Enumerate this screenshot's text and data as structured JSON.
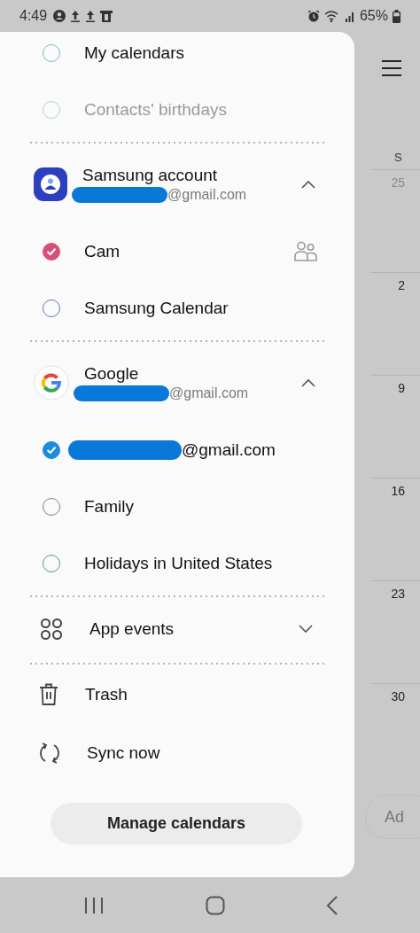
{
  "status_bar": {
    "time": "4:49",
    "battery": "65%"
  },
  "drawer": {
    "sections": [
      {
        "kind": "list",
        "items": [
          {
            "label": "My calendars",
            "redacted": false,
            "checked": false,
            "disabled": false,
            "shared": false,
            "color": "#7fb8c2"
          },
          {
            "label": "Contacts' birthdays",
            "redacted": false,
            "checked": false,
            "disabled": true,
            "shared": false,
            "color": "#a9d3da"
          }
        ]
      },
      {
        "kind": "account",
        "account": {
          "name": "Samsung account",
          "email": "@gmail.com",
          "redacted": true,
          "expanded": true
        },
        "items": [
          {
            "label": "Cam",
            "redacted": false,
            "checked": true,
            "disabled": false,
            "shared": true,
            "color": "#d6517a"
          },
          {
            "label": "Samsung Calendar",
            "redacted": false,
            "checked": false,
            "disabled": false,
            "shared": false,
            "color": "#5a7ab8"
          }
        ]
      },
      {
        "kind": "account",
        "account": {
          "name": "Google",
          "email": "@gmail.com",
          "redacted": true,
          "expanded": true
        },
        "items": [
          {
            "label": "@gmail.com",
            "redacted": true,
            "checked": true,
            "disabled": false,
            "shared": false,
            "color": "#1a8ddc"
          },
          {
            "label": "Family",
            "redacted": false,
            "checked": false,
            "disabled": false,
            "shared": false,
            "color": "#8a7d74"
          },
          {
            "label": "Holidays in United States",
            "redacted": false,
            "checked": false,
            "disabled": false,
            "shared": false,
            "color": "#4f9c84"
          }
        ]
      },
      {
        "kind": "group",
        "label": "App events",
        "expanded": false
      },
      {
        "kind": "actions",
        "items": [
          {
            "label": "Trash"
          },
          {
            "label": "Sync now"
          }
        ]
      }
    ],
    "manage_button": "Manage calendars"
  },
  "calendar": {
    "weekday": "S",
    "dates": [
      {
        "label": "25",
        "other_month": true
      },
      {
        "label": "2",
        "other_month": false
      },
      {
        "label": "9",
        "other_month": false
      },
      {
        "label": "16",
        "other_month": false
      },
      {
        "label": "23",
        "other_month": false
      },
      {
        "label": "30",
        "other_month": false
      }
    ],
    "add_button": "Ad"
  }
}
